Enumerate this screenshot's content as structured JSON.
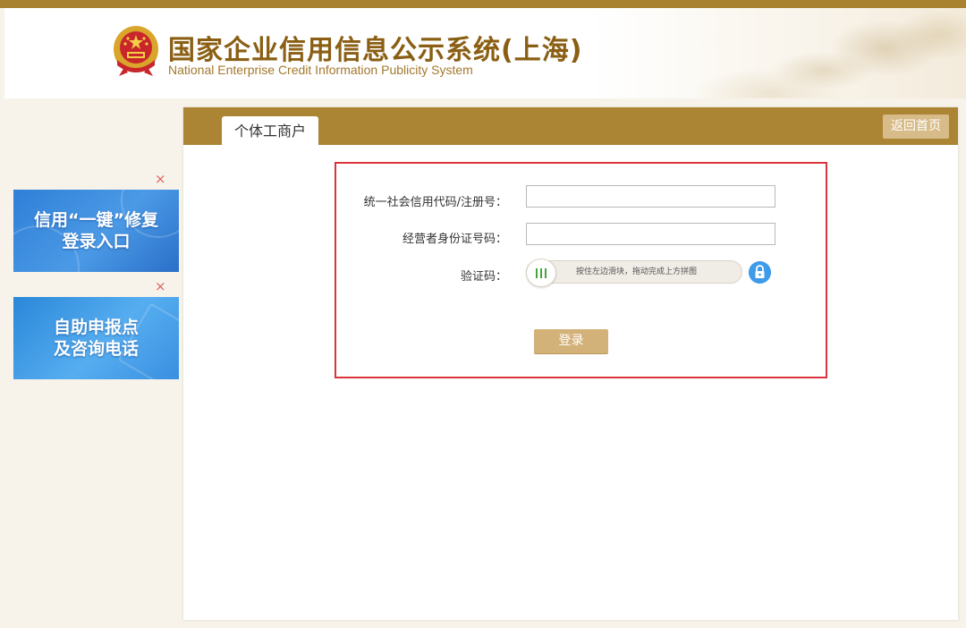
{
  "header": {
    "title": "国家企业信用信息公示系统(上海)",
    "subtitle": "National Enterprise Credit Information Publicity System",
    "emblem_icon": "national-emblem-icon"
  },
  "ads": [
    {
      "lines": [
        "信用“一键”修复",
        "登录入口"
      ],
      "close": "×"
    },
    {
      "lines": [
        "自助申报点",
        "及咨询电话"
      ],
      "close": "×"
    }
  ],
  "panel": {
    "tab_label": "个体工商户",
    "home_button": "返回首页"
  },
  "form": {
    "credit_code_label": "统一社会信用代码/注册号：",
    "credit_code_value": "",
    "id_label": "经营者身份证号码：",
    "id_value": "",
    "captcha_label": "验证码：",
    "slider_hint": "按住左边滑块，拖动完成上方拼图",
    "login_button": "登录"
  },
  "colors": {
    "brand_gold": "#ab8534",
    "title_brown": "#8a5f14",
    "highlight_red": "#d9343b",
    "lock_blue": "#3d9be9"
  }
}
